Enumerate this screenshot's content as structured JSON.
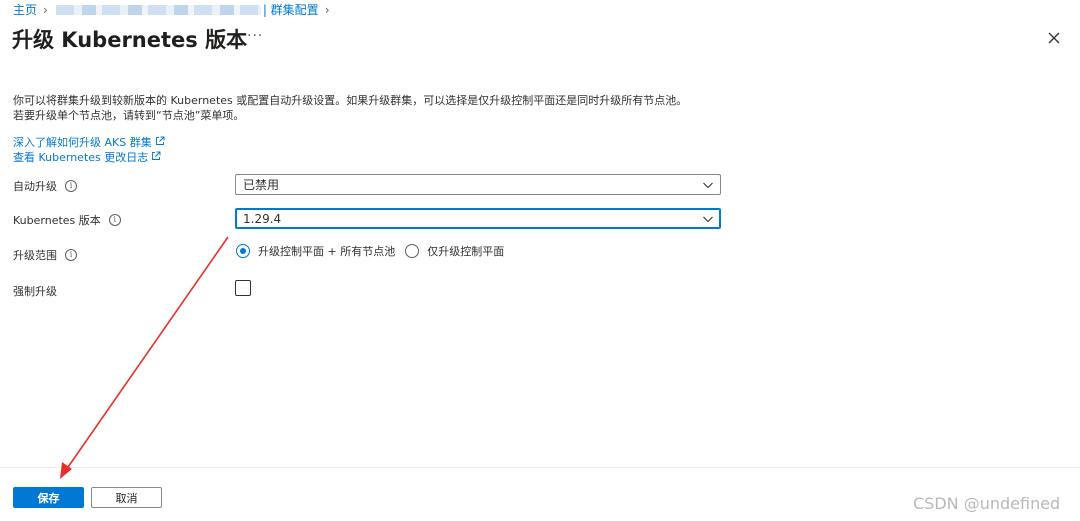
{
  "breadcrumb": {
    "home": "主页",
    "current": "| 群集配置"
  },
  "header": {
    "title": "升级 Kubernetes 版本",
    "more": "···"
  },
  "description": {
    "line1": "你可以将群集升级到较新版本的 Kubernetes 或配置自动升级设置。如果升级群集，可以选择是仅升级控制平面还是同时升级所有节点池。",
    "line2": "若要升级单个节点池，请转到“节点池”菜单项。"
  },
  "links": {
    "learn_more": "深入了解如何升级 AKS 群集",
    "changelog": "查看 Kubernetes 更改日志"
  },
  "form": {
    "auto_upgrade": {
      "label": "自动升级",
      "value": "已禁用"
    },
    "k8s_version": {
      "label": "Kubernetes 版本",
      "value": "1.29.4"
    },
    "scope": {
      "label": "升级范围",
      "options": [
        "升级控制平面 + 所有节点池",
        "仅升级控制平面"
      ],
      "selected_index": 0
    },
    "force": {
      "label": "强制升级",
      "checked": false
    }
  },
  "footer": {
    "save": "保存",
    "cancel": "取消"
  },
  "watermark": "CSDN @undefined",
  "colors": {
    "accent": "#0078d4",
    "annotation_arrow": "#e8302a"
  }
}
